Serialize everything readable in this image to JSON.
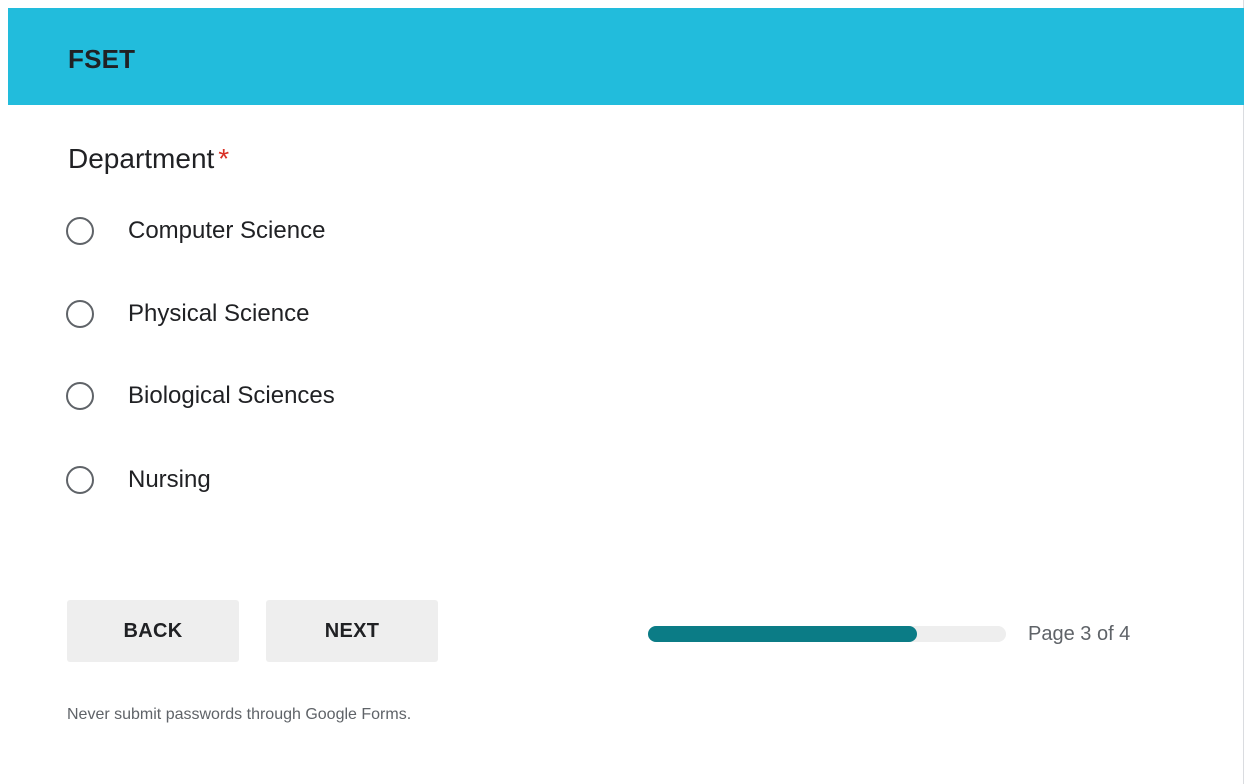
{
  "header": {
    "title": "FSET",
    "background_color": "#22bcdc"
  },
  "question": {
    "title": "Department",
    "required_marker": "*",
    "required_color": "#d93025",
    "options": [
      {
        "label": "Computer Science",
        "selected": false
      },
      {
        "label": "Physical Science",
        "selected": false
      },
      {
        "label": "Biological Sciences",
        "selected": false
      },
      {
        "label": "Nursing",
        "selected": false
      }
    ]
  },
  "navigation": {
    "back_label": "BACK",
    "next_label": "NEXT"
  },
  "progress": {
    "fraction": 0.75,
    "fill_color": "#0b7c86",
    "page_label": "Page 3 of 4"
  },
  "footer": {
    "note": "Never submit passwords through Google Forms."
  }
}
